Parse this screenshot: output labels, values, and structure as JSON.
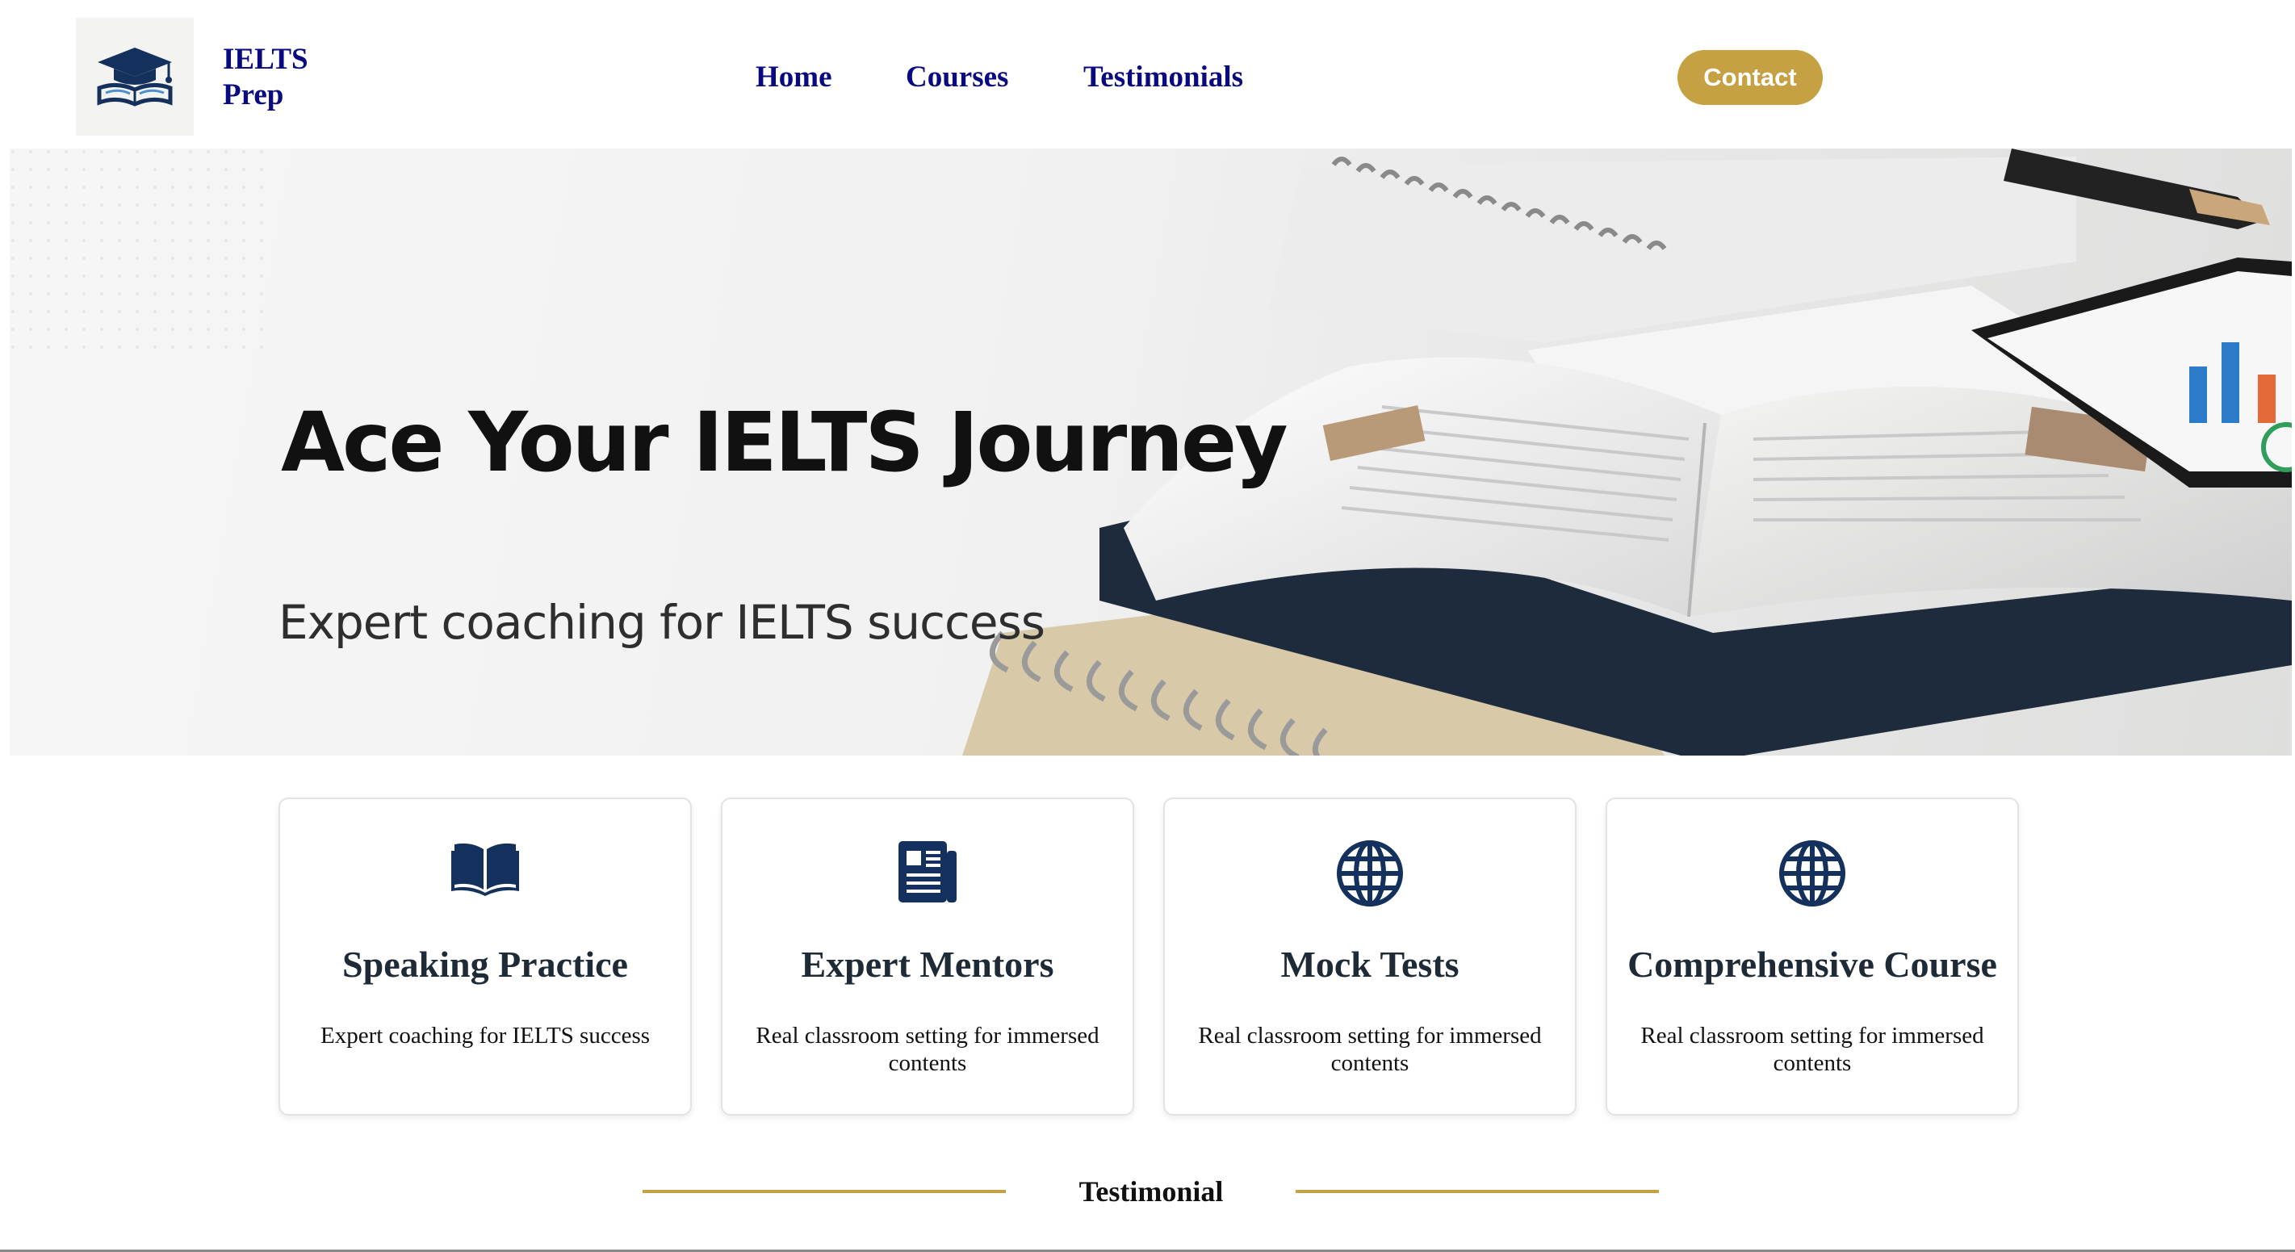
{
  "header": {
    "brand_line1": "IELTS",
    "brand_line2": "Prep",
    "logo_icon": "graduation-cap-book-icon",
    "nav": [
      "Home",
      "Courses",
      "Testimonials"
    ],
    "contact_label": "Contact"
  },
  "hero": {
    "title": "Ace Your IELTS Journey",
    "subtitle": "Expert coaching for IELTS success"
  },
  "features": [
    {
      "icon": "open-book-icon",
      "title": "Speaking Practice",
      "desc": "Expert coaching for IELTS success"
    },
    {
      "icon": "newspaper-icon",
      "title": "Expert Mentors",
      "desc": "Real classroom setting for immersed contents"
    },
    {
      "icon": "globe-icon",
      "title": "Mock Tests",
      "desc": "Real classroom setting for immersed contents"
    },
    {
      "icon": "globe-icon",
      "title": "Comprehensive Course",
      "desc": "Real classroom setting for immersed contents"
    }
  ],
  "testimonial": {
    "heading": "Testimonial"
  },
  "colors": {
    "navy": "#0a0a80",
    "gold": "#c6a143",
    "icon": "#14305c"
  }
}
